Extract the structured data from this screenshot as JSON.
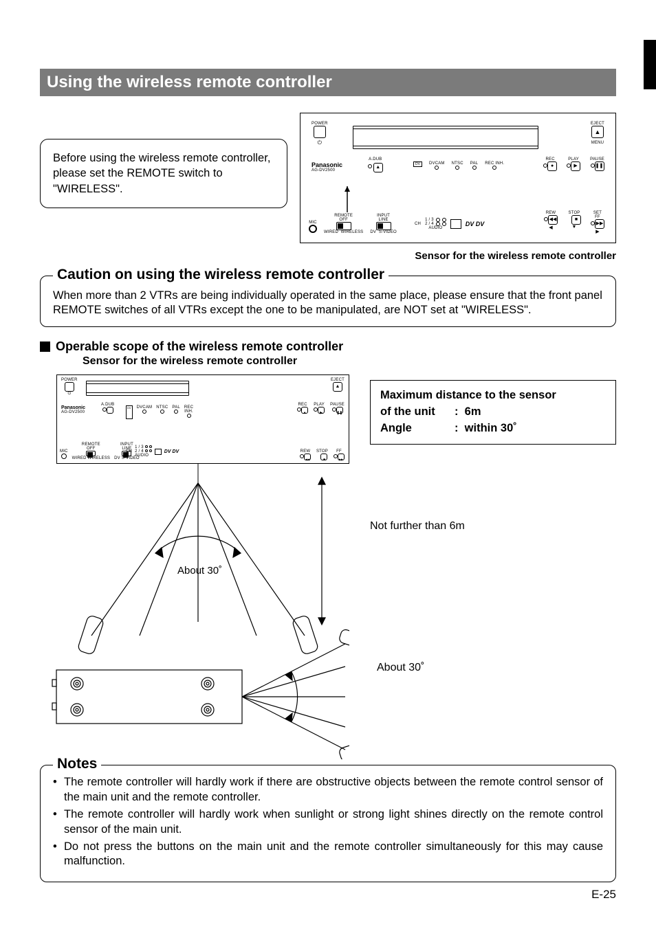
{
  "section_title": "Using the wireless remote controller",
  "intro_box": "Before using the wireless remote controller, please set the REMOTE switch to \"WIRELESS\".",
  "sensor_callout": "Sensor for the wireless remote controller",
  "caution": {
    "title": "Caution on using the wireless remote controller",
    "body": "When more than 2 VTRs are being individually operated in the same place, please ensure that the front panel REMOTE switches of all VTRs except the one to be manipulated, are NOT set at \"WIRELESS\"."
  },
  "scope": {
    "heading": "Operable scope of the wireless remote controller",
    "subheading": "Sensor for the wireless remote controller",
    "spec": {
      "line1": "Maximum distance to the sensor",
      "of_unit_label": "of the unit",
      "of_unit_value": "6m",
      "angle_label": "Angle",
      "angle_value": "within 30˚"
    },
    "labels": {
      "about30_1": "About 30˚",
      "about30_2": "About 30˚",
      "distance": "Not further than 6m"
    }
  },
  "notes": {
    "title": "Notes",
    "items": [
      "The remote controller will hardly work if there are obstructive objects between the remote control sensor of the main unit and the remote controller.",
      "The remote controller will hardly work when sunlight or strong light shines directly on the remote control sensor of the main unit.",
      "Do not press the buttons on the main unit and the remote controller simultaneously for this may cause malfunction."
    ]
  },
  "device": {
    "brand": "Panasonic",
    "model": "AG-DV2500",
    "labels": {
      "power": "POWER",
      "eject": "EJECT",
      "menu": "MENU",
      "adub": "A.DUB",
      "remote": "REMOTE",
      "off": "OFF",
      "wired": "WIRED",
      "wireless": "WIRELESS",
      "input": "INPUT",
      "line": "LINE",
      "dv": "DV",
      "svideo": "S-VIDEO",
      "mic": "MIC",
      "dvcam": "DVCAM",
      "ntsc": "NTSC",
      "pal": "PAL",
      "recinh": "REC INH.",
      "ch": "CH",
      "audio": "AUDIO",
      "ch13": "1 / 3",
      "ch24": "2 / 4",
      "rec": "REC",
      "play": "PLAY",
      "pause": "PAUSE",
      "rew": "REW",
      "stop": "STOP",
      "set": "SET",
      "ff": "FF",
      "dvlogo": "DV"
    }
  },
  "page": "E-25"
}
